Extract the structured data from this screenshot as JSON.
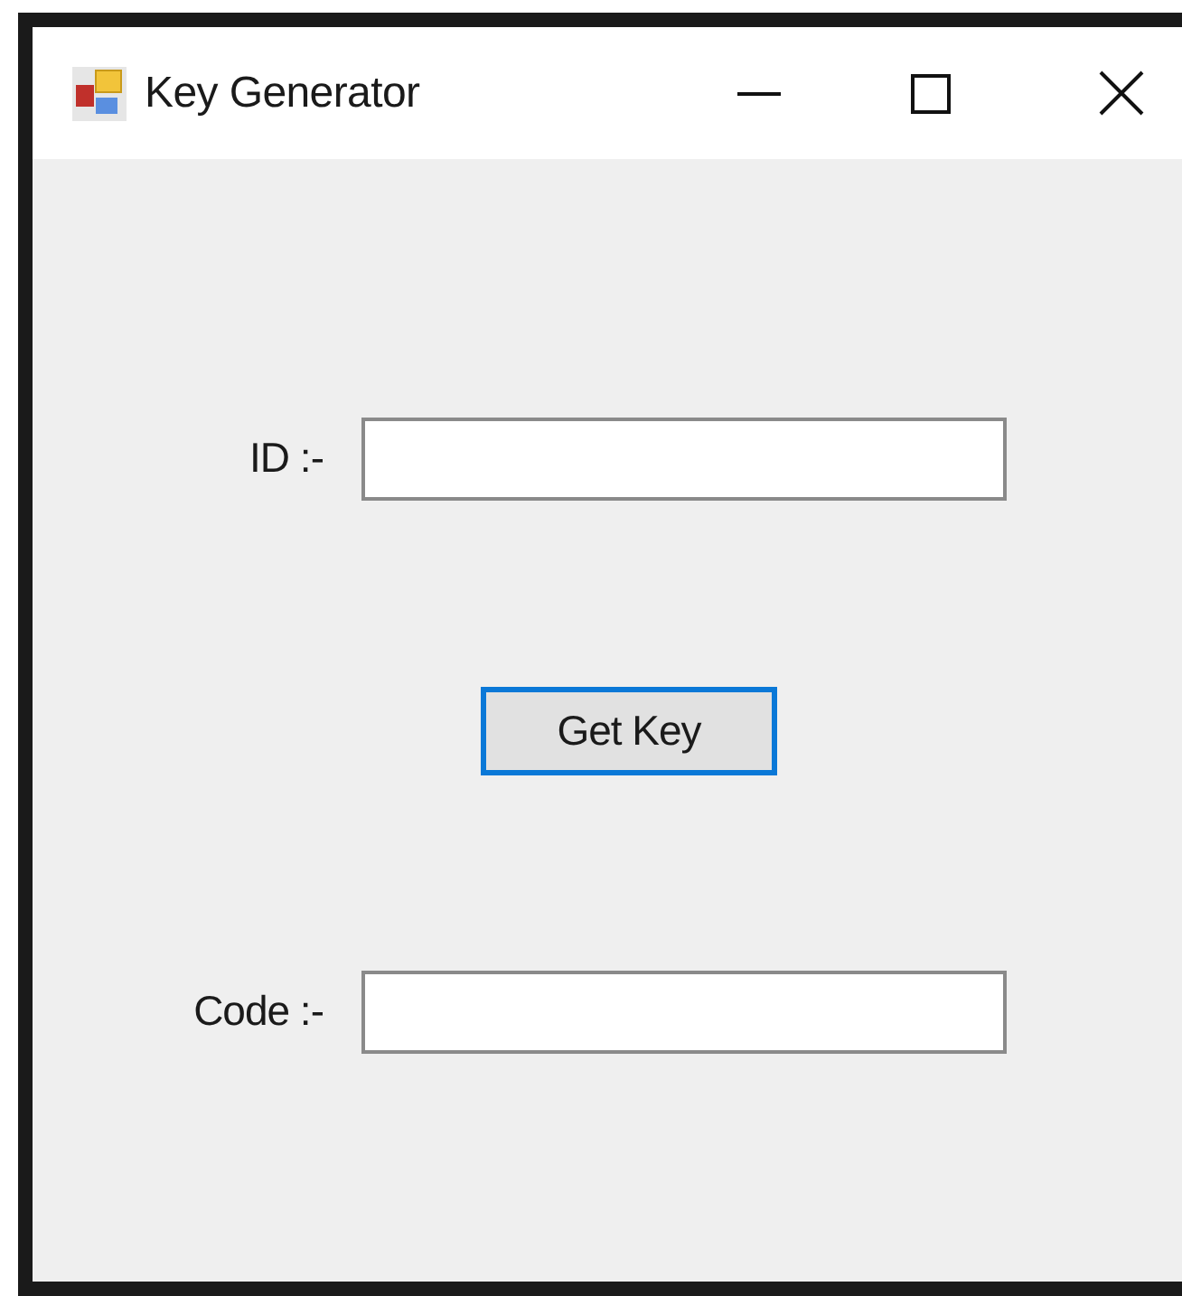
{
  "window": {
    "title": "Key Generator"
  },
  "form": [
    {
      "kind": "field",
      "label": "ID :-"
    },
    {
      "kind": "button",
      "label": "Get Key",
      "focused": true
    },
    {
      "kind": "field",
      "label": "Code :-"
    }
  ]
}
